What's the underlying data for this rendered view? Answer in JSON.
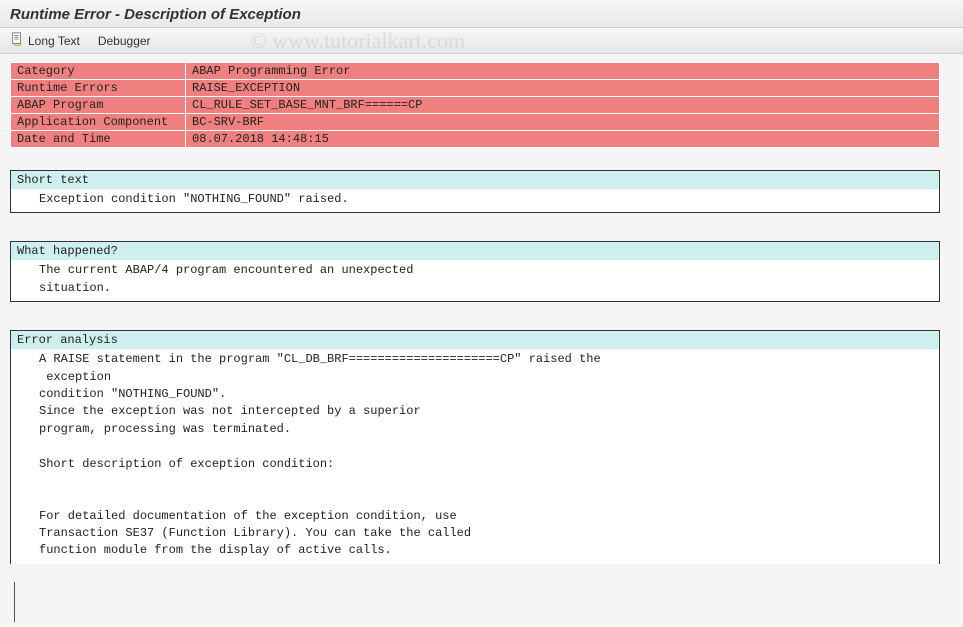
{
  "header": {
    "title": "Runtime Error - Description of Exception"
  },
  "toolbar": {
    "long_text_label": "Long Text",
    "debugger_label": "Debugger"
  },
  "info": {
    "rows": [
      {
        "label": "Category",
        "value": "ABAP Programming Error"
      },
      {
        "label": "Runtime Errors",
        "value": "RAISE_EXCEPTION"
      },
      {
        "label": "ABAP Program",
        "value": "CL_RULE_SET_BASE_MNT_BRF======CP"
      },
      {
        "label": "Application Component",
        "value": "BC-SRV-BRF"
      },
      {
        "label": "Date and Time",
        "value": "08.07.2018 14:48:15"
      }
    ]
  },
  "sections": {
    "short_text": {
      "title": "Short text",
      "lines": [
        "Exception condition \"NOTHING_FOUND\" raised."
      ]
    },
    "what_happened": {
      "title": "What happened?",
      "lines": [
        "The current ABAP/4 program encountered an unexpected",
        "situation."
      ]
    },
    "error_analysis": {
      "title": "Error analysis",
      "lines": [
        "A RAISE statement in the program \"CL_DB_BRF=====================CP\" raised the",
        " exception",
        "condition \"NOTHING_FOUND\".",
        "Since the exception was not intercepted by a superior",
        "program, processing was terminated.",
        "",
        "Short description of exception condition:",
        "",
        "",
        "For detailed documentation of the exception condition, use",
        "Transaction SE37 (Function Library). You can take the called",
        "function module from the display of active calls."
      ]
    }
  },
  "watermark": "© www.tutorialkart.com"
}
